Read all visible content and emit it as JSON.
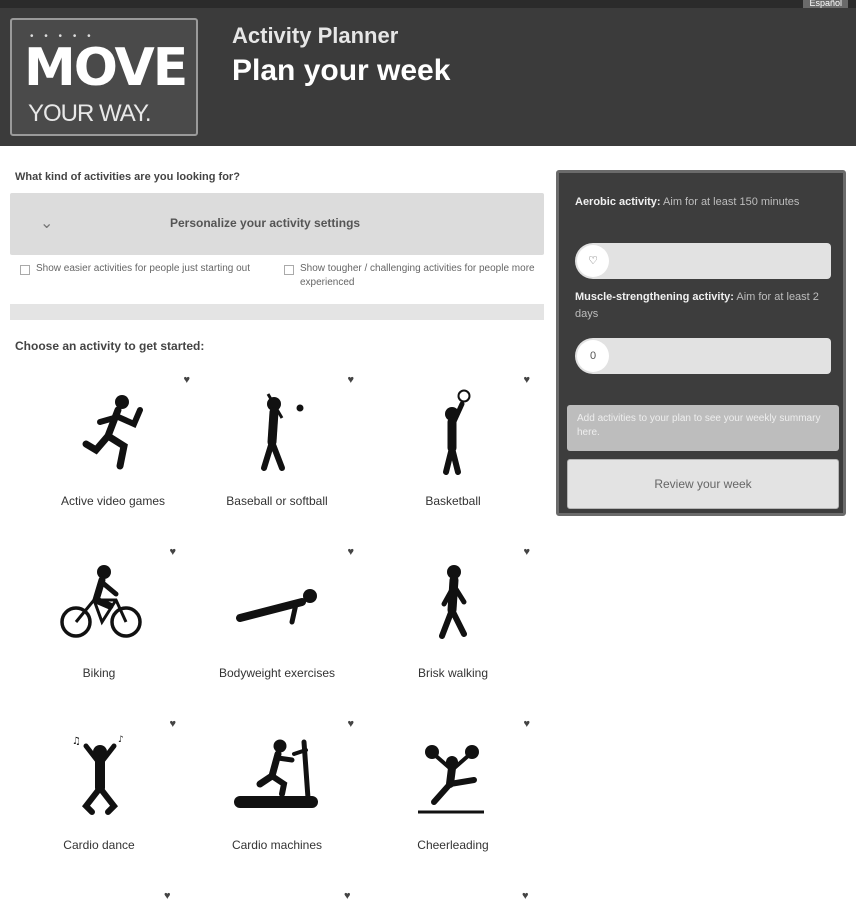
{
  "header": {
    "language_link": "Español",
    "logo_line1": "MOVE",
    "logo_line2": "YOUR WAY.",
    "app_title": "Activity Planner",
    "page_title": "Plan your week"
  },
  "filters": {
    "question": "What kind of activities are you looking for?",
    "personalize_label": "Personalize your activity settings",
    "option1": "Show easier activities for people just starting out",
    "option2": "Show tougher / challenging activities for people more experienced"
  },
  "activities": {
    "prompt": "Choose an activity to get started:",
    "items": [
      {
        "name": "Active video games",
        "icon": "runner-icon"
      },
      {
        "name": "Baseball or softball",
        "icon": "baseball-icon"
      },
      {
        "name": "Basketball",
        "icon": "basketball-icon"
      },
      {
        "name": "Biking",
        "icon": "bicycle-icon"
      },
      {
        "name": "Bodyweight exercises",
        "icon": "pushup-icon"
      },
      {
        "name": "Brisk walking",
        "icon": "walker-icon"
      },
      {
        "name": "Cardio dance",
        "icon": "dancer-icon"
      },
      {
        "name": "Cardio machines",
        "icon": "treadmill-icon"
      },
      {
        "name": "Cheerleading",
        "icon": "cheerleader-icon"
      }
    ]
  },
  "summary": {
    "aerobic_title": "Aerobic activity:",
    "aerobic_sub": "Aim for at least 150 minutes",
    "aerobic_value": "",
    "muscle_title": "Muscle-strengthening activity:",
    "muscle_sub": "Aim for at least 2 days",
    "muscle_value": "0",
    "note": "Add activities to your plan to see your weekly summary here.",
    "review_label": "Review your week"
  }
}
